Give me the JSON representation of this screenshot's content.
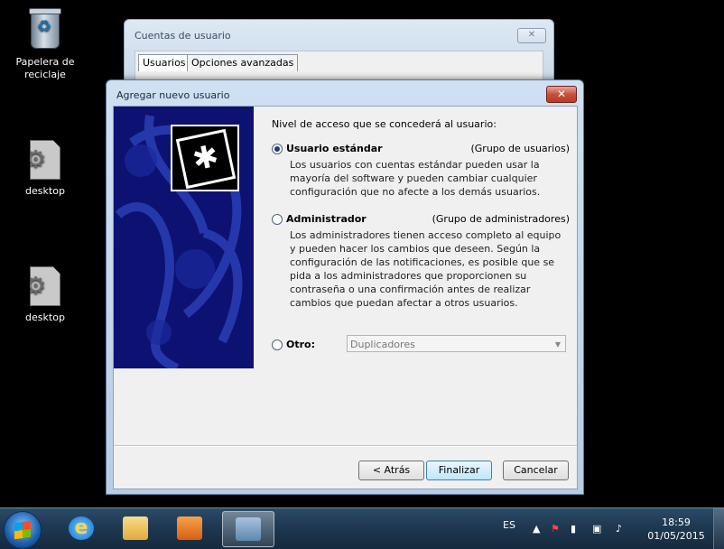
{
  "desktop": {
    "icons": [
      {
        "label": "Papelera de reciclaje",
        "icon": "recycle-bin-icon"
      },
      {
        "label": "desktop",
        "icon": "file-gear-icon"
      },
      {
        "label": "desktop",
        "icon": "file-gear-icon"
      }
    ]
  },
  "background_window": {
    "title": "Cuentas de usuario",
    "tabs": [
      "Usuarios",
      "Opciones avanzadas"
    ],
    "close_icon": "close-icon"
  },
  "dialog": {
    "title": "Agregar nuevo usuario",
    "lead": "Nivel de acceso que se concederá al usuario:",
    "options": [
      {
        "label": "Usuario estándar",
        "group": "(Grupo de usuarios)",
        "selected": true,
        "description": "Los usuarios con cuentas estándar pueden usar la mayoría del software y pueden cambiar cualquier configuración que no afecte a los demás usuarios."
      },
      {
        "label": "Administrador",
        "group": "(Grupo de administradores)",
        "selected": false,
        "description": "Los administradores tienen acceso completo al equipo y pueden hacer los cambios que deseen. Según la configuración de las notificaciones, es posible que se pida a los administradores que proporcionen su contraseña o una confirmación antes de realizar cambios que puedan afectar a otros usuarios."
      },
      {
        "label": "Otro:",
        "selected": false,
        "combo_value": "Duplicadores"
      }
    ],
    "buttons": {
      "back": "< Atrás",
      "finish": "Finalizar",
      "cancel": "Cancelar"
    }
  },
  "taskbar": {
    "apps": [
      {
        "name": "Internet Explorer",
        "icon": "internet-explorer-icon"
      },
      {
        "name": "Explorador de Windows",
        "icon": "folder-icon"
      },
      {
        "name": "Windows Media Player",
        "icon": "media-player-icon"
      },
      {
        "name": "Cuentas de usuario",
        "icon": "users-icon",
        "active": true
      }
    ],
    "language": "ES",
    "time": "18:59",
    "date": "01/05/2015"
  }
}
